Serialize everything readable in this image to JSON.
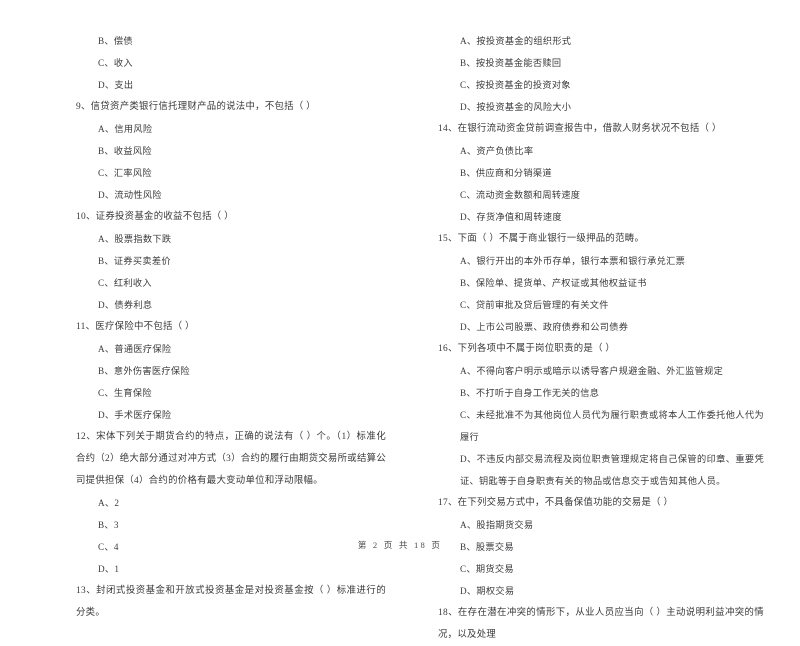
{
  "document": {
    "type": "exam-paper",
    "language": "zh-CN",
    "footer": "第 2 页 共 18 页"
  },
  "left_column": {
    "items": [
      {
        "kind": "option",
        "text": "B、偿债"
      },
      {
        "kind": "option",
        "text": "C、收入"
      },
      {
        "kind": "option",
        "text": "D、支出"
      },
      {
        "kind": "stem",
        "text": "9、信贷资产类银行信托理财产品的说法中，不包括（    ）"
      },
      {
        "kind": "option",
        "text": "A、信用风险"
      },
      {
        "kind": "option",
        "text": "B、收益风险"
      },
      {
        "kind": "option",
        "text": "C、汇率风险"
      },
      {
        "kind": "option",
        "text": "D、流动性风险"
      },
      {
        "kind": "stem",
        "text": "10、证券投资基金的收益不包括（    ）"
      },
      {
        "kind": "option",
        "text": "A、股票指数下跌"
      },
      {
        "kind": "option",
        "text": "B、证券买卖差价"
      },
      {
        "kind": "option",
        "text": "C、红利收入"
      },
      {
        "kind": "option",
        "text": "D、债券利息"
      },
      {
        "kind": "stem",
        "text": "11、医疗保险中不包括（    ）"
      },
      {
        "kind": "option",
        "text": "A、普通医疗保险"
      },
      {
        "kind": "option",
        "text": "B、意外伤害医疗保险"
      },
      {
        "kind": "option",
        "text": "C、生育保险"
      },
      {
        "kind": "option",
        "text": "D、手术医疗保险"
      },
      {
        "kind": "stem",
        "text": "12、宋体下列关于期货合约的特点，正确的说法有（    ）个。（1）标准化合约（2）绝大部分通过对冲方式（3）合约的履行由期货交易所或结算公司提供担保（4）合约的价格有最大变动单位和浮动限幅。"
      },
      {
        "kind": "option",
        "text": "A、2"
      },
      {
        "kind": "option",
        "text": "B、3"
      },
      {
        "kind": "option",
        "text": "C、4"
      },
      {
        "kind": "option",
        "text": "D、1"
      },
      {
        "kind": "stem",
        "text": "13、封闭式投资基金和开放式投资基金是对投资基金按（    ）标准进行的分类。"
      }
    ]
  },
  "right_column": {
    "items": [
      {
        "kind": "option",
        "text": "A、按投资基金的组织形式"
      },
      {
        "kind": "option",
        "text": "B、按投资基金能否赎回"
      },
      {
        "kind": "option",
        "text": "C、按投资基金的投资对象"
      },
      {
        "kind": "option",
        "text": "D、按投资基金的风险大小"
      },
      {
        "kind": "stem",
        "text": "14、在银行流动资金贷前调查报告中，借款人财务状况不包括（    ）"
      },
      {
        "kind": "option",
        "text": "A、资产负债比率"
      },
      {
        "kind": "option",
        "text": "B、供应商和分销渠道"
      },
      {
        "kind": "option",
        "text": "C、流动资金数额和周转速度"
      },
      {
        "kind": "option",
        "text": "D、存货净值和周转速度"
      },
      {
        "kind": "stem",
        "text": "15、下面（    ）不属于商业银行一级押品的范畴。"
      },
      {
        "kind": "option",
        "text": "A、银行开出的本外币存单，银行本票和银行承兑汇票"
      },
      {
        "kind": "option",
        "text": "B、保险单、提货单、产权证或其他权益证书"
      },
      {
        "kind": "option",
        "text": "C、贷前审批及贷后管理的有关文件"
      },
      {
        "kind": "option",
        "text": "D、上市公司股票、政府债券和公司债券"
      },
      {
        "kind": "stem",
        "text": "16、下列各项中不属于岗位职责的是（    ）"
      },
      {
        "kind": "option",
        "text": "A、不得向客户明示或暗示以诱导客户规避金融、外汇监管规定"
      },
      {
        "kind": "option",
        "text": "B、不打听于自身工作无关的信息"
      },
      {
        "kind": "option",
        "text": "C、未经批准不为其他岗位人员代为履行职责或将本人工作委托他人代为履行"
      },
      {
        "kind": "option",
        "text": "D、不违反内部交易流程及岗位职责管理规定将自己保管的印章、重要凭证、钥匙等于自身职责有关的物品或信息交于或告知其他人员。"
      },
      {
        "kind": "stem",
        "text": "17、在下列交易方式中，不具备保值功能的交易是（    ）"
      },
      {
        "kind": "option",
        "text": "A、股指期货交易"
      },
      {
        "kind": "option",
        "text": "B、股票交易"
      },
      {
        "kind": "option",
        "text": "C、期货交易"
      },
      {
        "kind": "option",
        "text": "D、期权交易"
      },
      {
        "kind": "stem",
        "text": "18、在存在潜在冲突的情形下，从业人员应当向（    ）主动说明利益冲突的情况，以及处理"
      }
    ]
  }
}
